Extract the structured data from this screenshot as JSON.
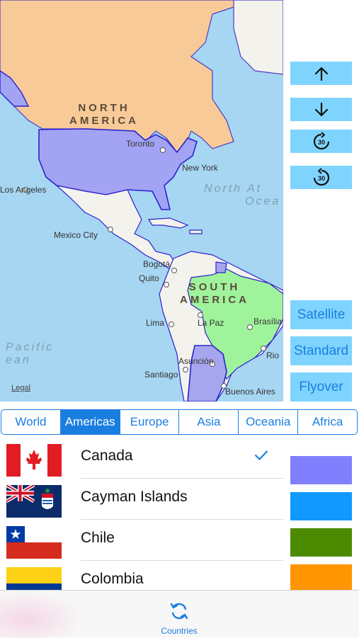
{
  "map": {
    "labels": {
      "north_america_1": "NORTH",
      "north_america_2": "AMERICA",
      "south_america_1": "SOUTH",
      "south_america_2": "AMERICA",
      "north_atlantic_1": "North At",
      "north_atlantic_2": "Ocea",
      "pacific_1": "Pacific",
      "pacific_2": "ean"
    },
    "cities": {
      "toronto": "Toronto",
      "new_york": "New York",
      "los_angeles": "Los Angeles",
      "mexico_city": "Mexico City",
      "bogota": "Bogotá",
      "quito": "Quito",
      "lima": "Lima",
      "la_paz": "La Paz",
      "brasilia": "Brasília",
      "rio": "Rio",
      "asuncion": "Asunción",
      "santiago": "Santiago",
      "buenos_aires": "Buenos Aires"
    },
    "legal": "Legal",
    "colors": {
      "water": "#a7d6f2",
      "north_america_land": "#f8ca97",
      "usa_highlight": "#a3a3f3",
      "brazil_highlight": "#9ff39a",
      "argentina_highlight": "#a6a6ee",
      "land": "#f4f2ec"
    }
  },
  "controls": {
    "up_icon": "arrow-up",
    "down_icon": "arrow-down",
    "forward_icon": "rotate-forward-30",
    "back_icon": "rotate-back-30",
    "rotate_value": "30"
  },
  "map_types": {
    "satellite": "Satellite",
    "standard": "Standard",
    "flyover": "Flyover"
  },
  "segments": [
    {
      "label": "World",
      "active": false
    },
    {
      "label": "Americas",
      "active": true
    },
    {
      "label": "Europe",
      "active": false
    },
    {
      "label": "Asia",
      "active": false
    },
    {
      "label": "Oceania",
      "active": false
    },
    {
      "label": "Africa",
      "active": false
    }
  ],
  "countries": [
    {
      "name": "Canada",
      "checked": true,
      "color": "#8080ff"
    },
    {
      "name": "Cayman Islands",
      "checked": false,
      "color": "#1199ff"
    },
    {
      "name": "Chile",
      "checked": false,
      "color": "#4c8a00"
    },
    {
      "name": "Colombia",
      "checked": false,
      "color": "#ff9500"
    }
  ],
  "tabbar": {
    "countries_label": "Countries",
    "icon": "refresh-icon",
    "accent": "#1a7ee0"
  }
}
